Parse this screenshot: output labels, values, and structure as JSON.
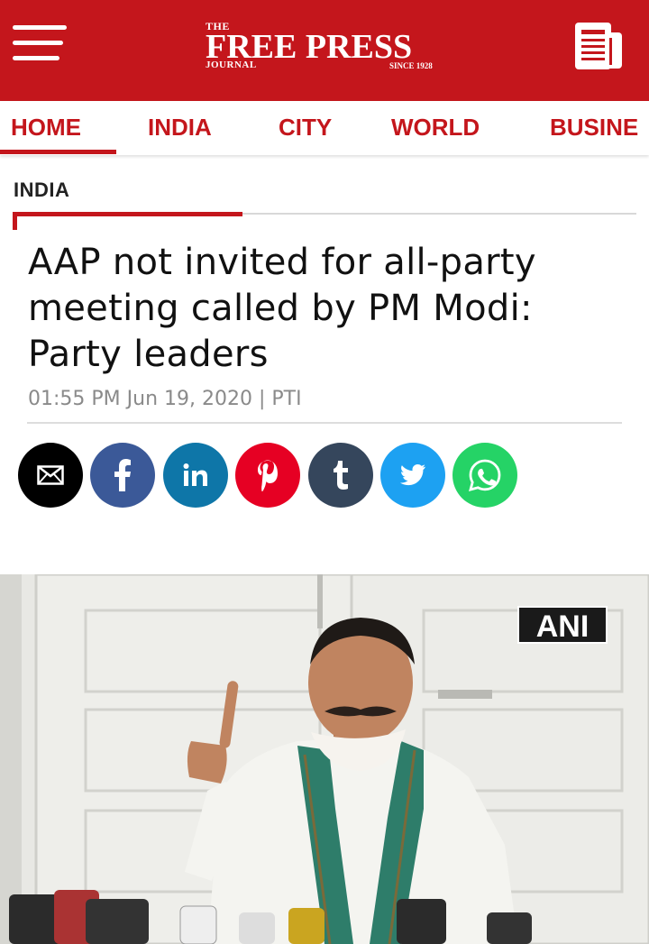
{
  "header": {
    "logo": {
      "the": "THE",
      "name": "FREE PRESS",
      "journal": "JOURNAL",
      "since": "SINCE 1928"
    },
    "background_color": "#c4161c",
    "menu_icon": "hamburger-menu-icon",
    "epaper_icon": "newspaper-icon"
  },
  "nav": {
    "items": [
      {
        "label": "HOME",
        "active": true
      },
      {
        "label": "INDIA"
      },
      {
        "label": "CITY"
      },
      {
        "label": "WORLD"
      },
      {
        "label": "BUSINE"
      }
    ]
  },
  "article": {
    "section": "INDIA",
    "headline": "AAP not invited for all-party meeting called by PM Modi: Party leaders",
    "meta": "01:55 PM Jun 19, 2020 | PTI",
    "share": [
      {
        "name": "email",
        "icon": "email-icon",
        "color": "#000000"
      },
      {
        "name": "facebook",
        "icon": "facebook-icon",
        "color": "#3b5998"
      },
      {
        "name": "linkedin",
        "icon": "linkedin-icon",
        "color": "#0e76a8"
      },
      {
        "name": "pinterest",
        "icon": "pinterest-icon",
        "color": "#e60023"
      },
      {
        "name": "tumblr",
        "icon": "tumblr-icon",
        "color": "#35465c"
      },
      {
        "name": "twitter",
        "icon": "twitter-icon",
        "color": "#1da1f2"
      },
      {
        "name": "whatsapp",
        "icon": "whatsapp-icon",
        "color": "#25d366"
      }
    ],
    "photo": {
      "watermark": "ANI"
    }
  }
}
